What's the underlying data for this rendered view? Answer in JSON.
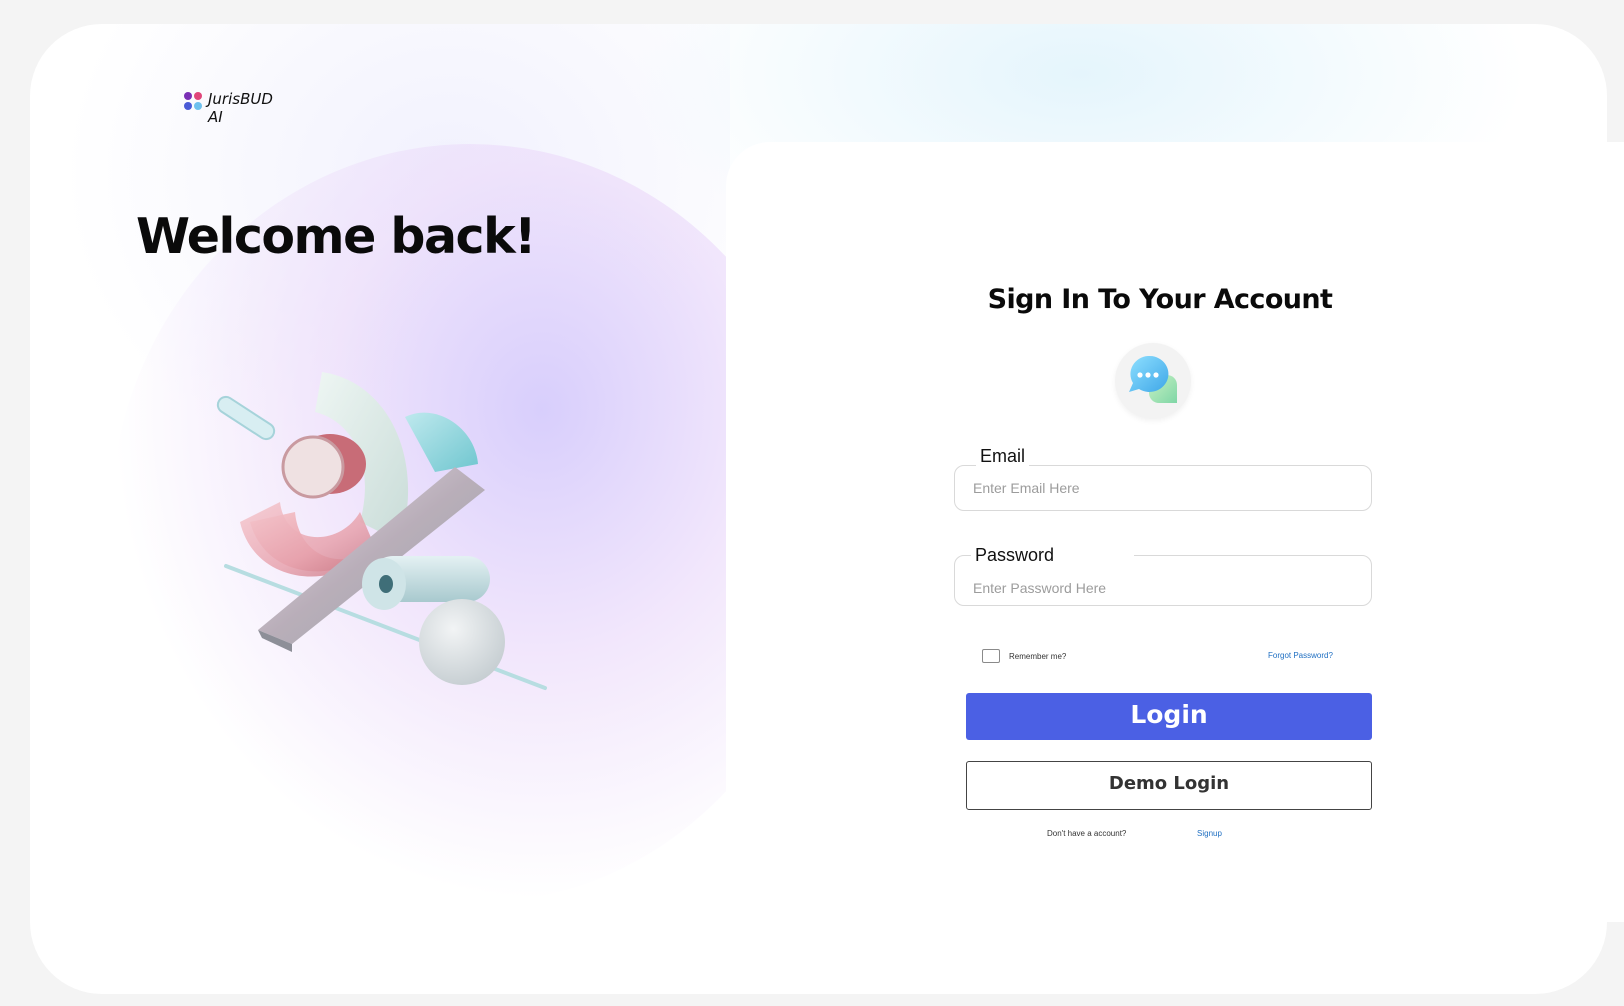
{
  "brand": {
    "name": "JurisBUD AI",
    "dot_colors": [
      "#7a2fb5",
      "#e0457a",
      "#4a5bd6",
      "#6ec1ee"
    ]
  },
  "hero": {
    "heading": "Welcome back!"
  },
  "form": {
    "title": "Sign In To Your Account",
    "email": {
      "label": "Email",
      "placeholder": "Enter Email Here",
      "value": ""
    },
    "password": {
      "label": "Password",
      "placeholder": "Enter Password Here",
      "value": ""
    },
    "remember_label": "Remember me?",
    "remember_checked": false,
    "forgot_label": "Forgot Password?",
    "login_label": "Login",
    "demo_label": "Demo Login",
    "no_account_text": "Don't have a account?",
    "signup_label": "Signup"
  },
  "colors": {
    "accent": "#4b60e4",
    "link": "#1f6fc2"
  },
  "icons": {
    "logo": "four-dots-logo-icon",
    "chat": "chat-bubbles-icon",
    "illustration": "abstract-3d-shapes"
  }
}
